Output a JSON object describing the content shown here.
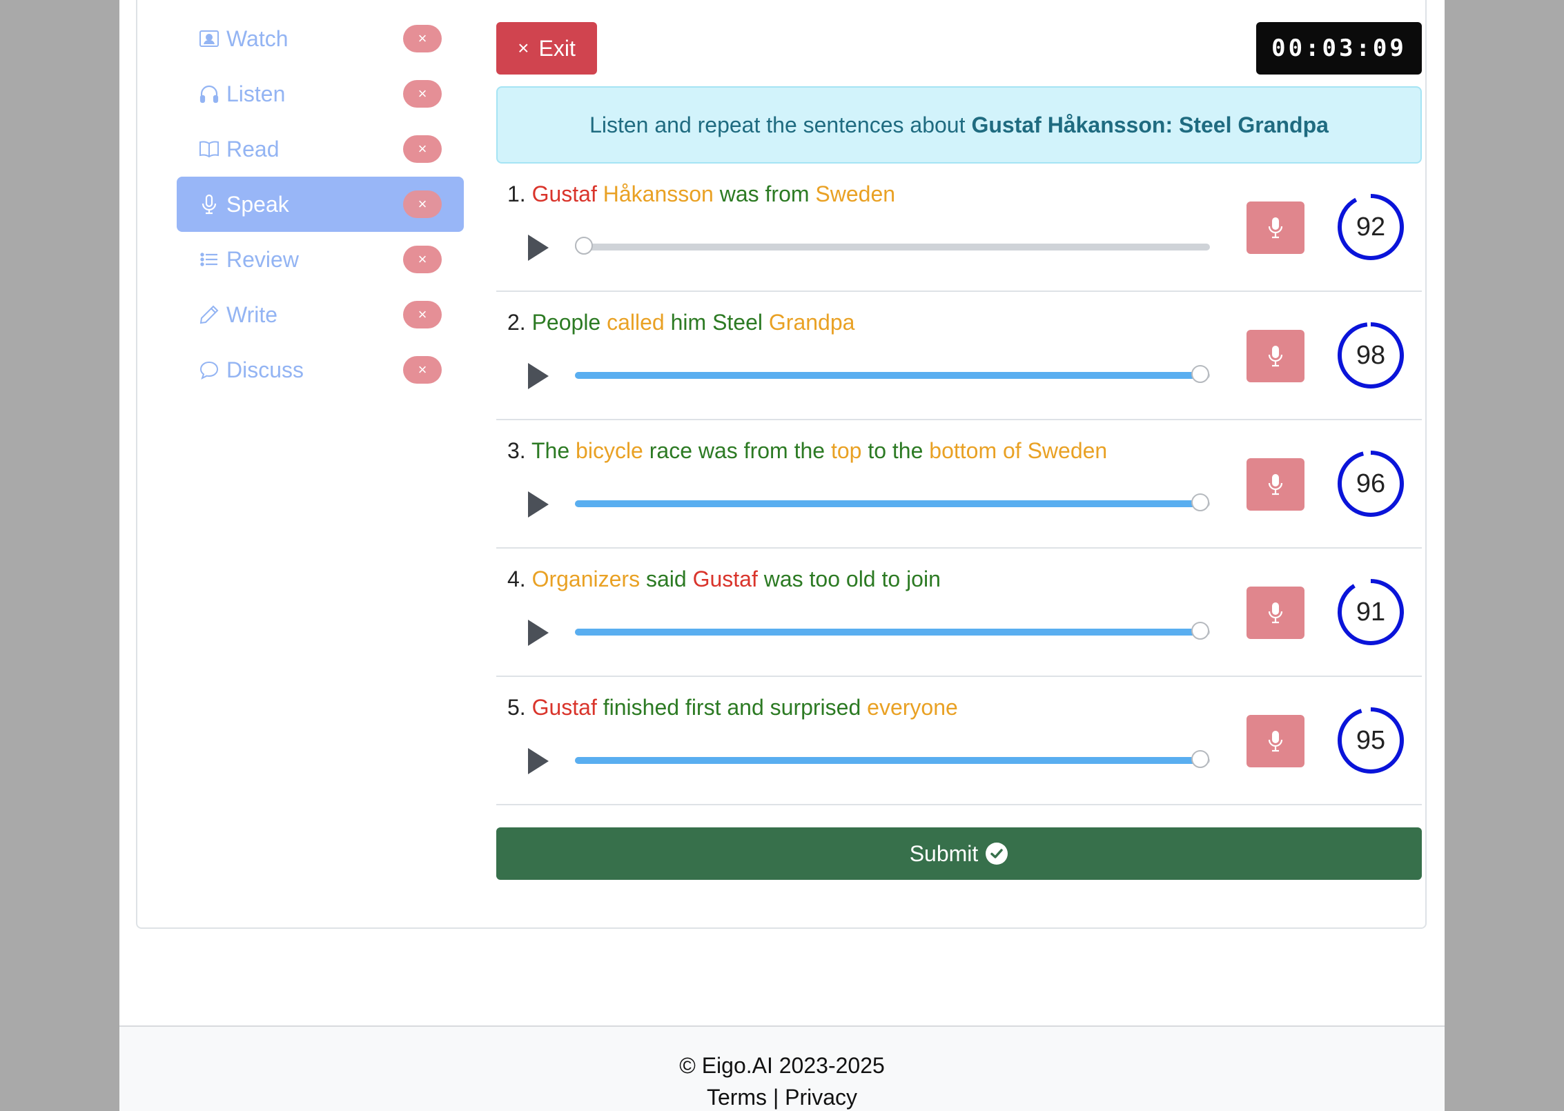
{
  "sidebar": {
    "items": [
      {
        "label": "Watch",
        "icon": "person-video-icon",
        "badge": "×",
        "active": false
      },
      {
        "label": "Listen",
        "icon": "headphones-icon",
        "badge": "×",
        "active": false
      },
      {
        "label": "Read",
        "icon": "book-icon",
        "badge": "×",
        "active": false
      },
      {
        "label": "Speak",
        "icon": "microphone-icon",
        "badge": "×",
        "active": true
      },
      {
        "label": "Review",
        "icon": "list-icon",
        "badge": "×",
        "active": false
      },
      {
        "label": "Write",
        "icon": "pencil-icon",
        "badge": "×",
        "active": false
      },
      {
        "label": "Discuss",
        "icon": "chat-icon",
        "badge": "×",
        "active": false
      }
    ]
  },
  "toolbar": {
    "exit_label": "Exit",
    "exit_icon": "×",
    "timer": "00:03:09"
  },
  "instruction": {
    "prefix": "Listen and repeat the sentences about",
    "topic": "Gustaf Håkansson: Steel Grandpa"
  },
  "colors": {
    "red_word": "#d9342b",
    "orange_word": "#e9a124",
    "green_word": "#2c7a23",
    "score_ring": "#0a14d9"
  },
  "sentences": [
    {
      "number": "1.",
      "words": [
        {
          "t": "Gustaf",
          "c": "red"
        },
        {
          "t": "Håkansson",
          "c": "orange"
        },
        {
          "t": "was",
          "c": "green"
        },
        {
          "t": "from",
          "c": "green"
        },
        {
          "t": "Sweden",
          "c": "orange"
        }
      ],
      "progress": 0.0,
      "score": "92"
    },
    {
      "number": "2.",
      "words": [
        {
          "t": "People",
          "c": "green"
        },
        {
          "t": "called",
          "c": "orange"
        },
        {
          "t": "him",
          "c": "green"
        },
        {
          "t": "Steel",
          "c": "green"
        },
        {
          "t": "Grandpa",
          "c": "orange"
        }
      ],
      "progress": 0.985,
      "score": "98"
    },
    {
      "number": "3.",
      "words": [
        {
          "t": "The",
          "c": "green"
        },
        {
          "t": "bicycle",
          "c": "orange"
        },
        {
          "t": "race",
          "c": "green"
        },
        {
          "t": "was",
          "c": "green"
        },
        {
          "t": "from",
          "c": "green"
        },
        {
          "t": "the",
          "c": "green"
        },
        {
          "t": "top",
          "c": "orange"
        },
        {
          "t": "to",
          "c": "green"
        },
        {
          "t": "the",
          "c": "green"
        },
        {
          "t": "bottom",
          "c": "orange"
        },
        {
          "t": "of",
          "c": "orange"
        },
        {
          "t": "Sweden",
          "c": "orange"
        }
      ],
      "progress": 0.985,
      "score": "96"
    },
    {
      "number": "4.",
      "words": [
        {
          "t": "Organizers",
          "c": "orange"
        },
        {
          "t": "said",
          "c": "green"
        },
        {
          "t": "Gustaf",
          "c": "red"
        },
        {
          "t": "was",
          "c": "green"
        },
        {
          "t": "too",
          "c": "green"
        },
        {
          "t": "old",
          "c": "green"
        },
        {
          "t": "to",
          "c": "green"
        },
        {
          "t": "join",
          "c": "green"
        }
      ],
      "progress": 0.985,
      "score": "91"
    },
    {
      "number": "5.",
      "words": [
        {
          "t": "Gustaf",
          "c": "red"
        },
        {
          "t": "finished",
          "c": "green"
        },
        {
          "t": "first",
          "c": "green"
        },
        {
          "t": "and",
          "c": "green"
        },
        {
          "t": "surprised",
          "c": "green"
        },
        {
          "t": "everyone",
          "c": "orange"
        }
      ],
      "progress": 0.985,
      "score": "95"
    }
  ],
  "submit": {
    "label": "Submit"
  },
  "footer": {
    "copyright": "© Eigo.AI 2023-2025",
    "terms": "Terms",
    "separator": "|",
    "privacy": "Privacy"
  }
}
